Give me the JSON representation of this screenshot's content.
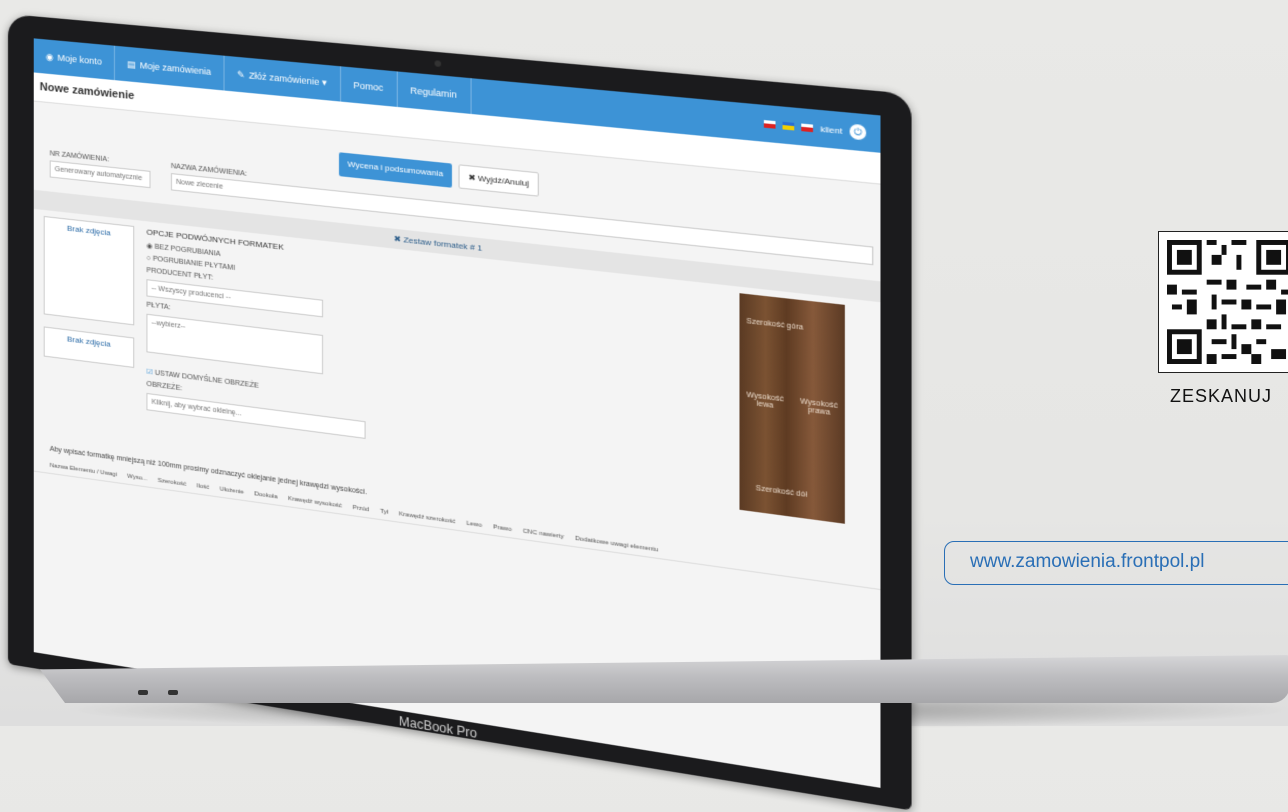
{
  "nav": {
    "items": [
      "Moje konto",
      "Moje zamówienia",
      "Złóż zamówienie ▾",
      "Pomoc",
      "Regulamin"
    ],
    "user": "klient"
  },
  "page": {
    "title": "Nowe zamówienie"
  },
  "toolbar": {
    "quote_label": "Wycena i podsumowania",
    "exit_label": "✖ Wyjdź/Anuluj"
  },
  "order": {
    "number_label": "NR ZAMÓWIENIA:",
    "number_value": "Generowany automatycznie",
    "name_label": "NAZWA ZAMÓWIENIA:",
    "name_placeholder": "Nowe zlecenie"
  },
  "set_bar": "✖ Zestaw formatek # 1",
  "photos": {
    "main": "Brak zdjęcia",
    "small": "Brak zdjęcia"
  },
  "options": {
    "title": "OPCJE PODWÓJNYCH FORMATEK",
    "radio1": "BEZ POGRUBIANIA",
    "radio2": "POGRUBIANIE PŁYTAMI",
    "producer_label": "PRODUCENT PŁYT:",
    "producer_value": "-- Wszyscy producenci --",
    "board_label": "PŁYTA:",
    "board_value": "--wybierz--",
    "edge_checkbox": "USTAW DOMYŚLNE OBRZEŻE",
    "edge_label": "OBRZEŻE:",
    "edge_placeholder": "Kliknij, aby wybrać okleinę..."
  },
  "board_image": {
    "top": "Szerokość góra",
    "left": "Wysokość lewa",
    "right": "Wysokość prawa",
    "bottom": "Szerokość dół"
  },
  "note": "Aby wpisać formatkę mniejszą niż 100mm prosimy odznaczyć oklejanie jednej krawędzi wysokości.",
  "table": {
    "columns": [
      "Nazwa Elementu / Uwagi",
      "Wyso...",
      "Szerokość",
      "Ilość",
      "Ułożenie",
      "Dookoła",
      "Przód",
      "Tył",
      "Lewo",
      "Prawo",
      "CNC nawierty",
      "Dodatkowe uwagi elementu"
    ],
    "groups": [
      "Krawędź wysokość",
      "Krawędź szerokość"
    ]
  },
  "laptop": {
    "brand": "MacBook Pro"
  },
  "promo": {
    "scan": "ZESKANUJ",
    "url": "www.zamowienia.frontpol.pl"
  }
}
